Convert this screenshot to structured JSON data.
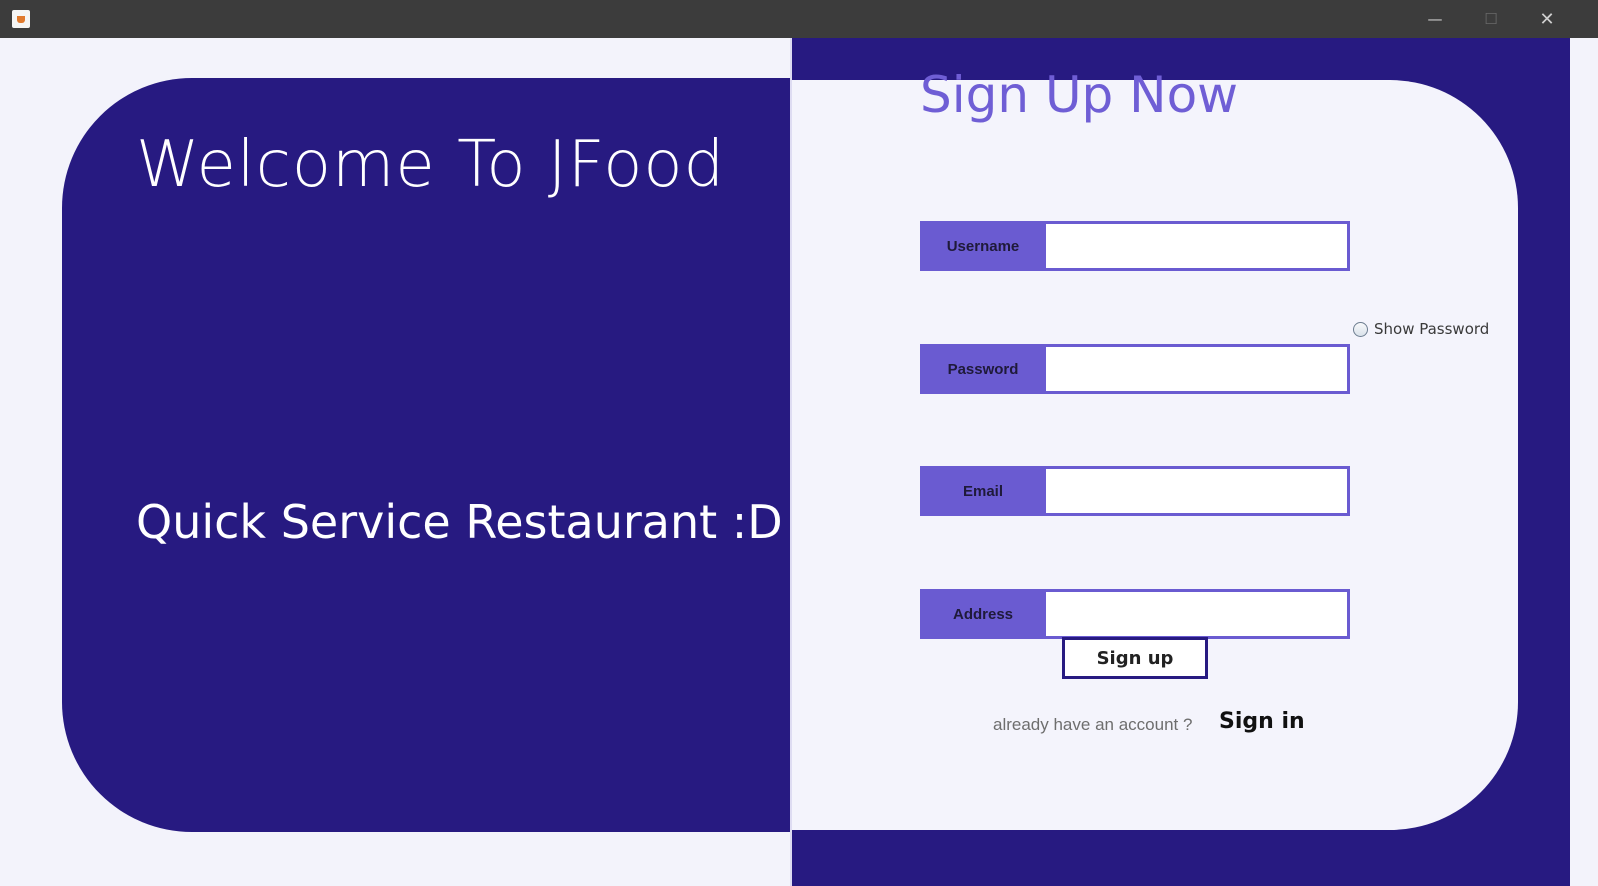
{
  "window": {
    "minimize_label": "—",
    "maximize_label": "☐",
    "close_label": "✕"
  },
  "left": {
    "welcome": "Welcome To JFood",
    "tagline": "Quick Service Restaurant :D"
  },
  "form": {
    "title": "Sign Up Now",
    "fields": [
      {
        "label": "Username",
        "value": ""
      },
      {
        "label": "Password",
        "value": ""
      },
      {
        "label": "Email",
        "value": ""
      },
      {
        "label": "Address",
        "value": ""
      }
    ],
    "show_password_label": "Show Password",
    "submit_label": "Sign up",
    "already_text": "already have an account ?",
    "signin_label": "Sign in"
  },
  "colors": {
    "primary_dark": "#271a81",
    "accent": "#6a5bd1",
    "background": "#f3f3fb"
  }
}
